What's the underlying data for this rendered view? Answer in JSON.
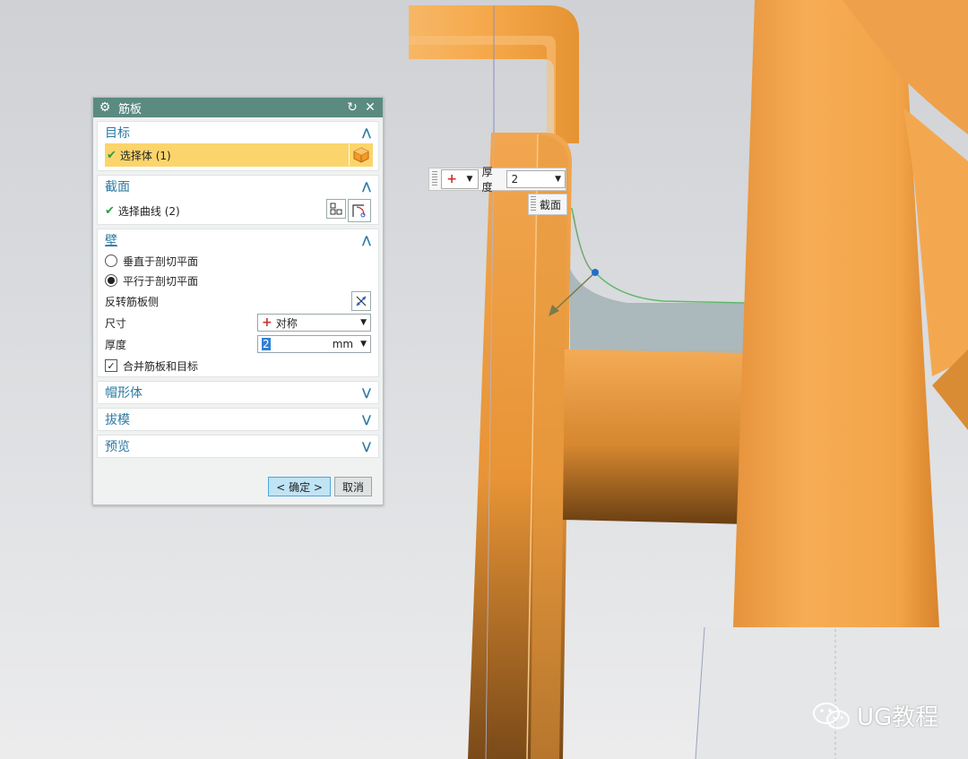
{
  "dialog": {
    "title": "筋板",
    "sections": {
      "target": {
        "header": "目标",
        "select_label": "选择体 (1)"
      },
      "section": {
        "header": "截面",
        "select_label": "选择曲线 (2)"
      },
      "wall": {
        "header": "壁",
        "option_perpendicular": "垂直于剖切平面",
        "option_parallel": "平行于剖切平面",
        "selected_option": "平行于剖切平面",
        "flip_label": "反转筋板侧",
        "dimension_label": "尺寸",
        "dimension_value": "对称",
        "thickness_label": "厚度",
        "thickness_value": "2",
        "thickness_unit": "mm",
        "combine_label": "合并筋板和目标",
        "combine_checked": true
      },
      "cap": {
        "header": "帽形体"
      },
      "draft": {
        "header": "拔模"
      },
      "preview": {
        "header": "预览"
      }
    },
    "ok_label": "< 确定 >",
    "cancel_label": "取消"
  },
  "floating_toolbar": {
    "thickness_label": "厚度",
    "thickness_value": "2",
    "section_tip": "截面"
  },
  "watermark": {
    "text": "UG教程",
    "icon": "wechat-icon"
  },
  "colors": {
    "title_bar": "#5a8a80",
    "accent": "#2c79a3",
    "selection": "#fbd56b",
    "model_orange": "#f2a44a",
    "check_green": "#28a04a"
  }
}
